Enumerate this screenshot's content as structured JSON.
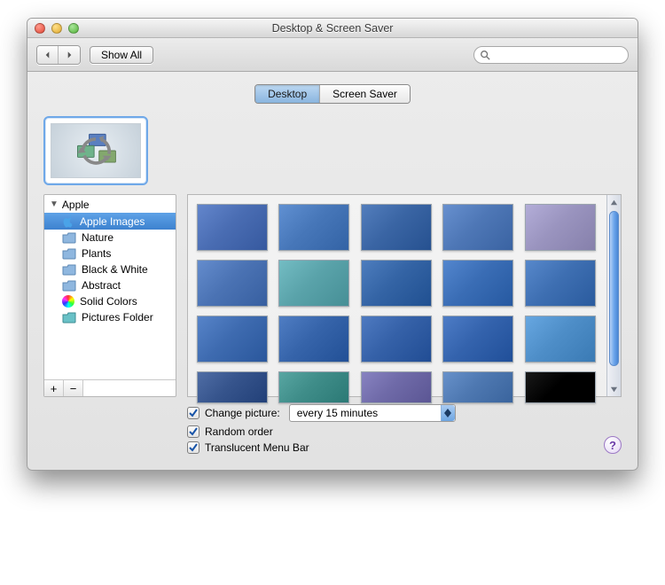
{
  "window": {
    "title": "Desktop & Screen Saver"
  },
  "toolbar": {
    "show_all_label": "Show All",
    "search_placeholder": ""
  },
  "tabs": {
    "desktop": "Desktop",
    "screensaver": "Screen Saver",
    "selected": "desktop"
  },
  "sidebar": {
    "group_label": "Apple",
    "items": [
      {
        "label": "Apple Images",
        "icon": "apple",
        "selected": true
      },
      {
        "label": "Nature",
        "icon": "folder"
      },
      {
        "label": "Plants",
        "icon": "folder"
      },
      {
        "label": "Black & White",
        "icon": "folder"
      },
      {
        "label": "Abstract",
        "icon": "folder"
      },
      {
        "label": "Solid Colors",
        "icon": "colorwheel"
      },
      {
        "label": "Pictures Folder",
        "icon": "folder-teal"
      }
    ]
  },
  "thumbnails": {
    "colors": [
      "#4a6db3",
      "#4777b9",
      "#3a65a4",
      "#4e77b6",
      "#9a94bf",
      "#4b73b4",
      "#5aa3aa",
      "#3464a5",
      "#3a6db5",
      "#3e6fb2",
      "#3e6bb0",
      "#3664aa",
      "#3561a8",
      "#3463ad",
      "#4e8ec8",
      "#36548c",
      "#3f8d89",
      "#6f6aa8",
      "#4e78b1",
      "#000000"
    ]
  },
  "options": {
    "change_picture_label": "Change picture:",
    "change_interval": "every 15 minutes",
    "random_order_label": "Random order",
    "translucent_label": "Translucent Menu Bar",
    "change_picture_checked": true,
    "random_order_checked": true,
    "translucent_checked": true
  },
  "buttons": {
    "plus": "+",
    "minus": "−",
    "help": "?"
  }
}
